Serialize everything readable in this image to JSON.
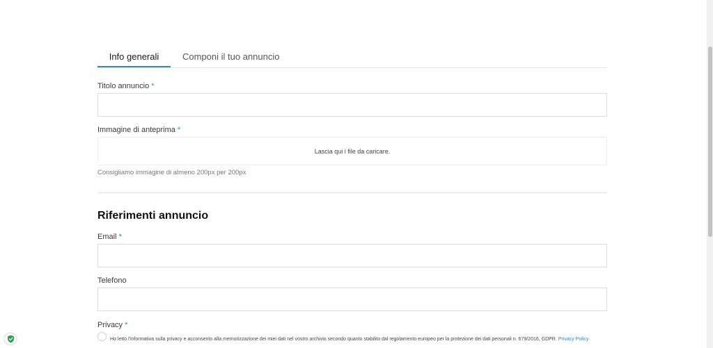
{
  "tabs": {
    "general": "Info generali",
    "compose": "Componi il tuo annuncio"
  },
  "fields": {
    "title_label": "Titolo annuncio",
    "image_label": "Immagine di anteprima",
    "dropzone_text": "Lascia qui i file da caricare.",
    "image_hint": "Consigliamo immagine di almeno 200px per 200px",
    "email_label": "Email",
    "phone_label": "Telefono",
    "privacy_label": "Privacy",
    "required_mark": "*"
  },
  "section": {
    "title": "Riferimenti annuncio"
  },
  "privacy": {
    "text": "Ho letto l'informativa sulla privacy e acconsento alla memorizzazione dei miei dati nel vostro archivio secondo quanto stabilito dal regolamento europeo per la protezione dei dati personali n. 679/2016, GDPR.",
    "link": "Privacy Policy"
  },
  "colors": {
    "accent": "#2f87c9",
    "badge": "#2e9e4f"
  },
  "icons": {
    "badge": "shield-check-icon"
  }
}
